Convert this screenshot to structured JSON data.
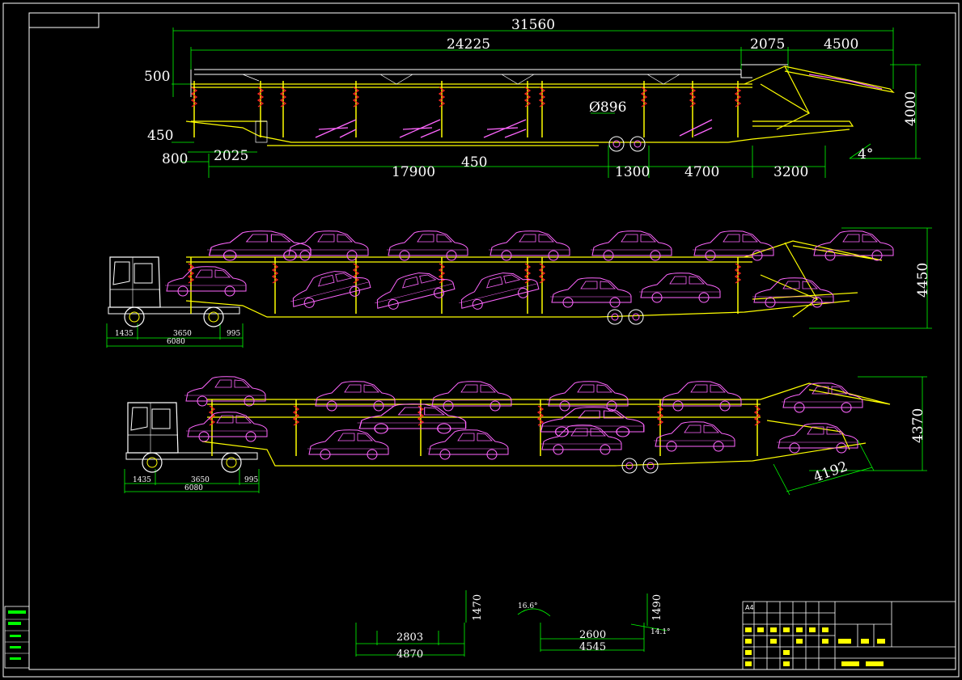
{
  "colors": {
    "background": "#000000",
    "frame": "#ffffff",
    "dimension": "#00ff00",
    "structure": "#ffff00",
    "cars": "#ff66ff",
    "hydraulic": "#ff2222",
    "tractor": "#ffffff"
  },
  "side_view": {
    "dims": {
      "overall": "31560",
      "deck_length": "24225",
      "front_upper": "2075",
      "front_extension": "4500",
      "rear_overhang_top": "500",
      "lower_deck_height": "450",
      "kingpin_height": "800",
      "gooseneck": "2025",
      "main_span": "17900",
      "deck_gap": "450",
      "wheel_diameter": "Ø896",
      "axle_spacing": "1300",
      "axle_to_front": "4700",
      "front_ramp": "3200",
      "ramp_angle": "4°",
      "overall_height": "4000"
    }
  },
  "loaded_view_a": {
    "height": "4450",
    "tractor_dims": {
      "front": "1435",
      "wheelbase": "3650",
      "rear": "995",
      "total": "6080"
    }
  },
  "loaded_view_b": {
    "height": "4370",
    "ramp_length": "4192",
    "tractor_dims": {
      "front": "1435",
      "wheelbase": "3650",
      "rear": "995",
      "total": "6080"
    }
  },
  "car_samples": {
    "sedan_a": {
      "wheelbase": "2803",
      "length": "4870",
      "height": "1470"
    },
    "sedan_b": {
      "wheelbase": "2600",
      "length": "4545",
      "height": "1490",
      "angle_front": "16.6°",
      "angle_rear": "14.1°"
    }
  },
  "title_block": {
    "sheet_size": "A4"
  }
}
